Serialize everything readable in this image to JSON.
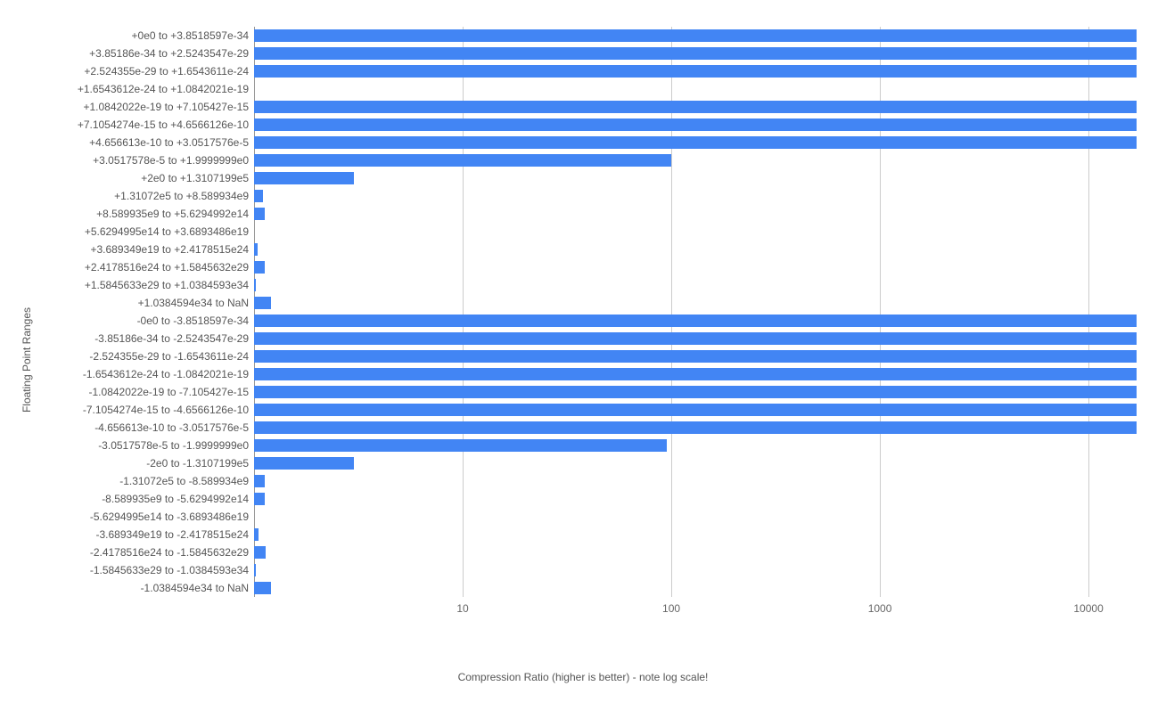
{
  "chart_data": {
    "type": "bar",
    "orientation": "horizontal",
    "title": "",
    "xlabel": "Compression Ratio (higher is better) - note log scale!",
    "ylabel": "Floating Point Ranges",
    "xscale": "log",
    "xmin": 1,
    "xmax": 17000,
    "xticks": [
      10,
      100,
      1000,
      10000
    ],
    "categories": [
      "+0e0 to +3.8518597e-34",
      "+3.85186e-34 to +2.5243547e-29",
      "+2.524355e-29 to +1.6543611e-24",
      "+1.6543612e-24 to +1.0842021e-19",
      "+1.0842022e-19 to +7.105427e-15",
      "+7.1054274e-15 to +4.6566126e-10",
      "+4.656613e-10 to +3.0517576e-5",
      "+3.0517578e-5 to +1.9999999e0",
      "+2e0 to +1.3107199e5",
      "+1.31072e5 to +8.589934e9",
      "+8.589935e9 to +5.6294992e14",
      "+5.6294995e14 to +3.6893486e19",
      "+3.689349e19 to +2.4178515e24",
      "+2.4178516e24 to +1.5845632e29",
      "+1.5845633e29 to +1.0384593e34",
      "+1.0384594e34 to NaN",
      "-0e0 to -3.8518597e-34",
      "-3.85186e-34 to -2.5243547e-29",
      "-2.524355e-29 to -1.6543611e-24",
      "-1.6543612e-24 to -1.0842021e-19",
      "-1.0842022e-19 to -7.105427e-15",
      "-7.1054274e-15 to -4.6566126e-10",
      "-4.656613e-10 to -3.0517576e-5",
      "-3.0517578e-5 to -1.9999999e0",
      "-2e0 to -1.3107199e5",
      "-1.31072e5 to -8.589934e9",
      "-8.589935e9 to -5.6294992e14",
      "-5.6294995e14 to -3.6893486e19",
      "-3.689349e19 to -2.4178515e24",
      "-2.4178516e24 to -1.5845632e29",
      "-1.5845633e29 to -1.0384593e34",
      "-1.0384594e34 to NaN"
    ],
    "values": [
      17000,
      17000,
      17000,
      null,
      17000,
      17000,
      17000,
      100,
      3,
      1.1,
      1.12,
      null,
      1.04,
      1.12,
      1.02,
      1.2,
      17000,
      17000,
      17000,
      17000,
      17000,
      17000,
      17000,
      95,
      3,
      1.12,
      1.12,
      null,
      1.05,
      1.14,
      1.02,
      1.2
    ],
    "bar_color": "#4285f4"
  }
}
